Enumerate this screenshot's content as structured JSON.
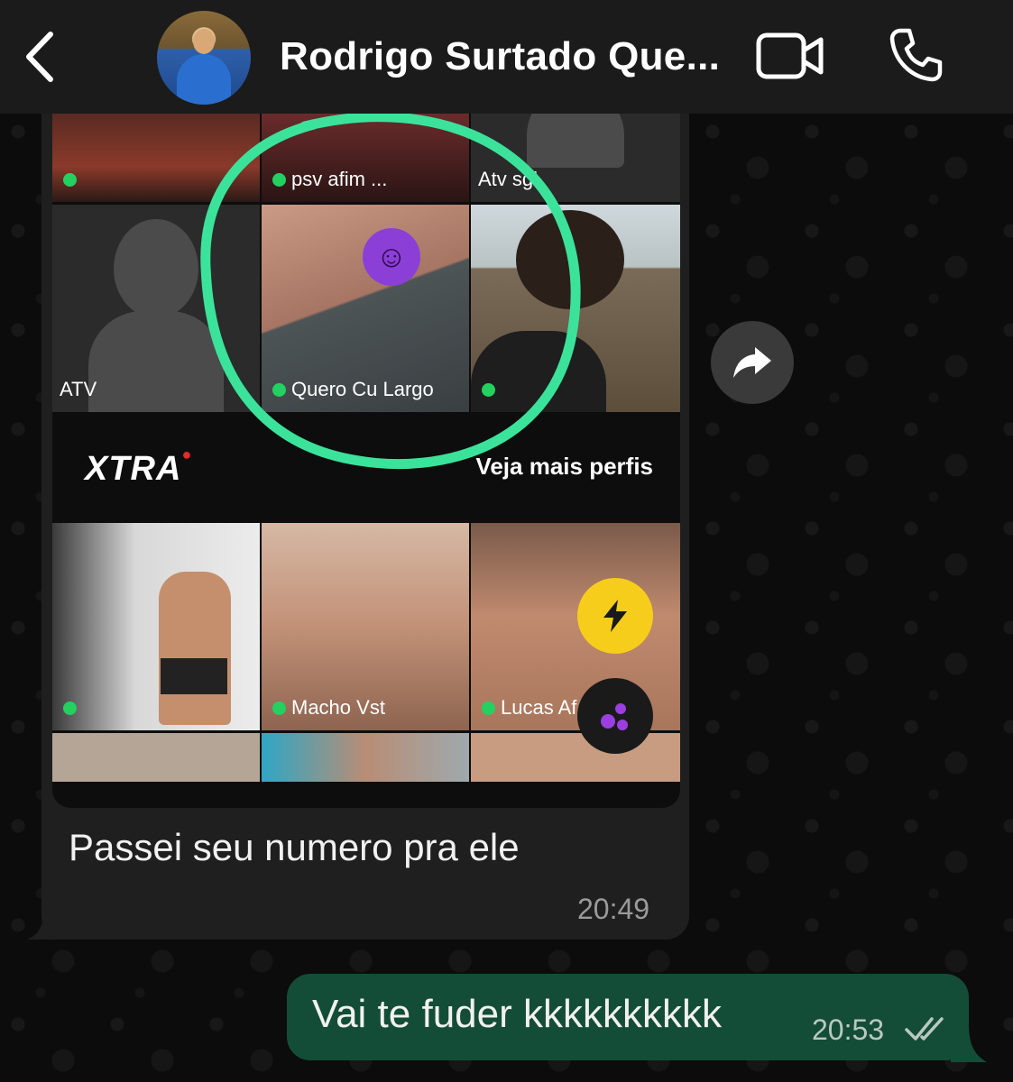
{
  "header": {
    "contact_name": "Rodrigo Surtado Que..."
  },
  "incoming": {
    "shared_image": {
      "top_row": [
        {
          "label": "",
          "online": true
        },
        {
          "label": "psv afim ...",
          "online": true
        },
        {
          "label": "Atv sgl",
          "online": false
        }
      ],
      "middle_row": [
        {
          "label": "ATV",
          "online": false
        },
        {
          "label": "Quero Cu Largo",
          "online": true
        },
        {
          "label": "",
          "online": true
        }
      ],
      "banner": {
        "logo": "XTRA",
        "link": "Veja mais perfis"
      },
      "bottom_row": [
        {
          "label": "",
          "online": true
        },
        {
          "label": "Macho Vst",
          "online": true
        },
        {
          "label": "Lucas Af",
          "online": true
        }
      ]
    },
    "text": "Passei seu numero pra ele",
    "time": "20:49"
  },
  "outgoing": {
    "text": "Vai te fuder kkkkkkkkkk",
    "time": "20:53"
  },
  "colors": {
    "header_bg": "#1b1b1b",
    "incoming_bubble": "#1f1f1f",
    "outgoing_bubble": "#144d37",
    "highlight": "#3be39a",
    "online_dot": "#23d160",
    "bolt_fab": "#f7cd1b"
  }
}
